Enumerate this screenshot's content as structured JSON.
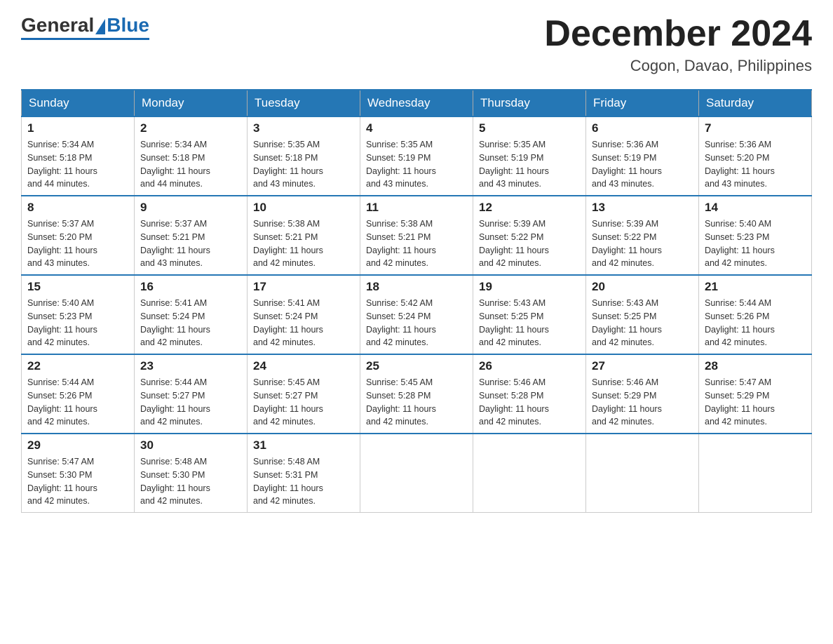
{
  "logo": {
    "general": "General",
    "blue": "Blue"
  },
  "header": {
    "month": "December 2024",
    "location": "Cogon, Davao, Philippines"
  },
  "weekdays": [
    "Sunday",
    "Monday",
    "Tuesday",
    "Wednesday",
    "Thursday",
    "Friday",
    "Saturday"
  ],
  "weeks": [
    [
      {
        "day": "1",
        "sunrise": "5:34 AM",
        "sunset": "5:18 PM",
        "daylight": "11 hours and 44 minutes."
      },
      {
        "day": "2",
        "sunrise": "5:34 AM",
        "sunset": "5:18 PM",
        "daylight": "11 hours and 44 minutes."
      },
      {
        "day": "3",
        "sunrise": "5:35 AM",
        "sunset": "5:18 PM",
        "daylight": "11 hours and 43 minutes."
      },
      {
        "day": "4",
        "sunrise": "5:35 AM",
        "sunset": "5:19 PM",
        "daylight": "11 hours and 43 minutes."
      },
      {
        "day": "5",
        "sunrise": "5:35 AM",
        "sunset": "5:19 PM",
        "daylight": "11 hours and 43 minutes."
      },
      {
        "day": "6",
        "sunrise": "5:36 AM",
        "sunset": "5:19 PM",
        "daylight": "11 hours and 43 minutes."
      },
      {
        "day": "7",
        "sunrise": "5:36 AM",
        "sunset": "5:20 PM",
        "daylight": "11 hours and 43 minutes."
      }
    ],
    [
      {
        "day": "8",
        "sunrise": "5:37 AM",
        "sunset": "5:20 PM",
        "daylight": "11 hours and 43 minutes."
      },
      {
        "day": "9",
        "sunrise": "5:37 AM",
        "sunset": "5:21 PM",
        "daylight": "11 hours and 43 minutes."
      },
      {
        "day": "10",
        "sunrise": "5:38 AM",
        "sunset": "5:21 PM",
        "daylight": "11 hours and 42 minutes."
      },
      {
        "day": "11",
        "sunrise": "5:38 AM",
        "sunset": "5:21 PM",
        "daylight": "11 hours and 42 minutes."
      },
      {
        "day": "12",
        "sunrise": "5:39 AM",
        "sunset": "5:22 PM",
        "daylight": "11 hours and 42 minutes."
      },
      {
        "day": "13",
        "sunrise": "5:39 AM",
        "sunset": "5:22 PM",
        "daylight": "11 hours and 42 minutes."
      },
      {
        "day": "14",
        "sunrise": "5:40 AM",
        "sunset": "5:23 PM",
        "daylight": "11 hours and 42 minutes."
      }
    ],
    [
      {
        "day": "15",
        "sunrise": "5:40 AM",
        "sunset": "5:23 PM",
        "daylight": "11 hours and 42 minutes."
      },
      {
        "day": "16",
        "sunrise": "5:41 AM",
        "sunset": "5:24 PM",
        "daylight": "11 hours and 42 minutes."
      },
      {
        "day": "17",
        "sunrise": "5:41 AM",
        "sunset": "5:24 PM",
        "daylight": "11 hours and 42 minutes."
      },
      {
        "day": "18",
        "sunrise": "5:42 AM",
        "sunset": "5:24 PM",
        "daylight": "11 hours and 42 minutes."
      },
      {
        "day": "19",
        "sunrise": "5:43 AM",
        "sunset": "5:25 PM",
        "daylight": "11 hours and 42 minutes."
      },
      {
        "day": "20",
        "sunrise": "5:43 AM",
        "sunset": "5:25 PM",
        "daylight": "11 hours and 42 minutes."
      },
      {
        "day": "21",
        "sunrise": "5:44 AM",
        "sunset": "5:26 PM",
        "daylight": "11 hours and 42 minutes."
      }
    ],
    [
      {
        "day": "22",
        "sunrise": "5:44 AM",
        "sunset": "5:26 PM",
        "daylight": "11 hours and 42 minutes."
      },
      {
        "day": "23",
        "sunrise": "5:44 AM",
        "sunset": "5:27 PM",
        "daylight": "11 hours and 42 minutes."
      },
      {
        "day": "24",
        "sunrise": "5:45 AM",
        "sunset": "5:27 PM",
        "daylight": "11 hours and 42 minutes."
      },
      {
        "day": "25",
        "sunrise": "5:45 AM",
        "sunset": "5:28 PM",
        "daylight": "11 hours and 42 minutes."
      },
      {
        "day": "26",
        "sunrise": "5:46 AM",
        "sunset": "5:28 PM",
        "daylight": "11 hours and 42 minutes."
      },
      {
        "day": "27",
        "sunrise": "5:46 AM",
        "sunset": "5:29 PM",
        "daylight": "11 hours and 42 minutes."
      },
      {
        "day": "28",
        "sunrise": "5:47 AM",
        "sunset": "5:29 PM",
        "daylight": "11 hours and 42 minutes."
      }
    ],
    [
      {
        "day": "29",
        "sunrise": "5:47 AM",
        "sunset": "5:30 PM",
        "daylight": "11 hours and 42 minutes."
      },
      {
        "day": "30",
        "sunrise": "5:48 AM",
        "sunset": "5:30 PM",
        "daylight": "11 hours and 42 minutes."
      },
      {
        "day": "31",
        "sunrise": "5:48 AM",
        "sunset": "5:31 PM",
        "daylight": "11 hours and 42 minutes."
      },
      null,
      null,
      null,
      null
    ]
  ],
  "labels": {
    "sunrise": "Sunrise:",
    "sunset": "Sunset:",
    "daylight": "Daylight:"
  }
}
